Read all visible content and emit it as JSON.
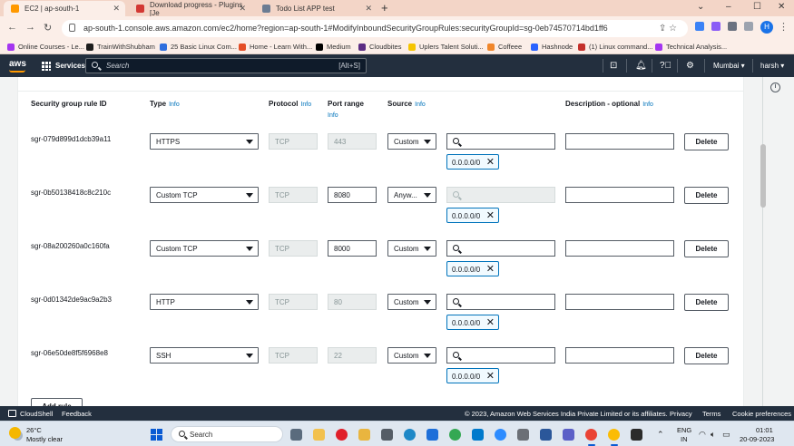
{
  "browser": {
    "tabs": [
      {
        "title": "EC2 | ap-south-1",
        "favicon_color": "#ff9900",
        "active": true
      },
      {
        "title": "Download progress - Plugins [Je",
        "favicon_color": "#d33833",
        "active": false
      },
      {
        "title": "Todo List APP test",
        "favicon_color": "#6b7c93",
        "active": false
      }
    ],
    "url": "ap-south-1.console.aws.amazon.com/ec2/home?region=ap-south-1#ModifyInboundSecurityGroupRules:securityGroupId=sg-0eb74570714bd1ff6",
    "profile_initial": "H",
    "bookmarks": [
      {
        "label": "Online Courses - Le...",
        "color": "#a435f0"
      },
      {
        "label": "TrainWithShubham",
        "color": "#1d1d1d"
      },
      {
        "label": "25 Basic Linux Com...",
        "color": "#2f6fde"
      },
      {
        "label": "Home - Learn With...",
        "color": "#e44d26"
      },
      {
        "label": "Medium",
        "color": "#000000"
      },
      {
        "label": "Cloudbites",
        "color": "#5b2c83"
      },
      {
        "label": "Uplers Talent Soluti...",
        "color": "#f5c400"
      },
      {
        "label": "Coffeee",
        "color": "#f0862b"
      },
      {
        "label": "Hashnode",
        "color": "#2962ff"
      },
      {
        "label": "(1) Linux command...",
        "color": "#c4302b"
      },
      {
        "label": "Technical Analysis...",
        "color": "#a435f0"
      }
    ]
  },
  "aws": {
    "logo": "aws",
    "services_label": "Services",
    "search_placeholder": "Search",
    "search_shortcut": "[Alt+S]",
    "region": "Mumbai",
    "user": "harsh",
    "accent": "#ff9900",
    "header_bg": "#232f3e"
  },
  "table": {
    "headers": {
      "rule_id": "Security group rule ID",
      "type": "Type",
      "protocol": "Protocol",
      "port_range": "Port range",
      "source": "Source",
      "description": "Description - optional",
      "info": "Info"
    },
    "rows": [
      {
        "rule_id": "sgr-079d899d1dcb39a11",
        "type": "HTTPS",
        "protocol": "TCP",
        "port": "443",
        "port_editable": false,
        "source": "Custom",
        "source_search_enabled": true,
        "cidr": "0.0.0.0/0",
        "description": "",
        "delete": "Delete"
      },
      {
        "rule_id": "sgr-0b50138418c8c210c",
        "type": "Custom TCP",
        "protocol": "TCP",
        "port": "8080",
        "port_editable": true,
        "source": "Anyw...",
        "source_search_enabled": false,
        "cidr": "0.0.0.0/0",
        "description": "",
        "delete": "Delete"
      },
      {
        "rule_id": "sgr-08a200260a0c160fa",
        "type": "Custom TCP",
        "protocol": "TCP",
        "port": "8000",
        "port_editable": true,
        "source": "Custom",
        "source_search_enabled": true,
        "cidr": "0.0.0.0/0",
        "description": "",
        "delete": "Delete"
      },
      {
        "rule_id": "sgr-0d01342de9ac9a2b3",
        "type": "HTTP",
        "protocol": "TCP",
        "port": "80",
        "port_editable": false,
        "source": "Custom",
        "source_search_enabled": true,
        "cidr": "0.0.0.0/0",
        "description": "",
        "delete": "Delete"
      },
      {
        "rule_id": "sgr-06e50de8f5f6968e8",
        "type": "SSH",
        "protocol": "TCP",
        "port": "22",
        "port_editable": false,
        "source": "Custom",
        "source_search_enabled": true,
        "cidr": "0.0.0.0/0",
        "description": "",
        "delete": "Delete"
      }
    ],
    "add_rule_label": "Add rule"
  },
  "footer": {
    "cloudshell": "CloudShell",
    "feedback": "Feedback",
    "copyright": "© 2023, Amazon Web Services India Private Limited or its affiliates.",
    "privacy": "Privacy",
    "terms": "Terms",
    "cookies": "Cookie preferences"
  },
  "taskbar": {
    "temperature": "26°C",
    "weather": "Mostly clear",
    "search_placeholder": "Search",
    "lang1": "ENG",
    "lang2": "IN",
    "time": "01:01",
    "date": "20-09-2023",
    "apps": [
      {
        "name": "file-explorer-icon",
        "color": "#f2c14e"
      },
      {
        "name": "edge-icon",
        "color": "#1e88c7"
      },
      {
        "name": "opera-icon",
        "color": "#e0202b"
      },
      {
        "name": "notepad-icon",
        "color": "#555d66"
      },
      {
        "name": "folder-icon",
        "color": "#e9b53f"
      },
      {
        "name": "browser-icon",
        "color": "#1e6fd9"
      },
      {
        "name": "chrome-icon",
        "color": "#34a853"
      },
      {
        "name": "vscode-icon",
        "color": "#007acc"
      },
      {
        "name": "zoom-icon",
        "color": "#2d8cff"
      },
      {
        "name": "settings-icon",
        "color": "#6b6f76"
      },
      {
        "name": "word-icon",
        "color": "#2b579a"
      },
      {
        "name": "photos-icon",
        "color": "#4aa3df"
      },
      {
        "name": "teams-icon",
        "color": "#5b5fc7"
      },
      {
        "name": "mail-icon",
        "color": "#0f6cbd"
      },
      {
        "name": "chrome-icon-2",
        "color": "#ea4335"
      },
      {
        "name": "chrome-icon-3",
        "color": "#fbbc05"
      },
      {
        "name": "sticky-icon",
        "color": "#f7d046"
      },
      {
        "name": "terminal-icon",
        "color": "#2b2b2b"
      }
    ]
  }
}
